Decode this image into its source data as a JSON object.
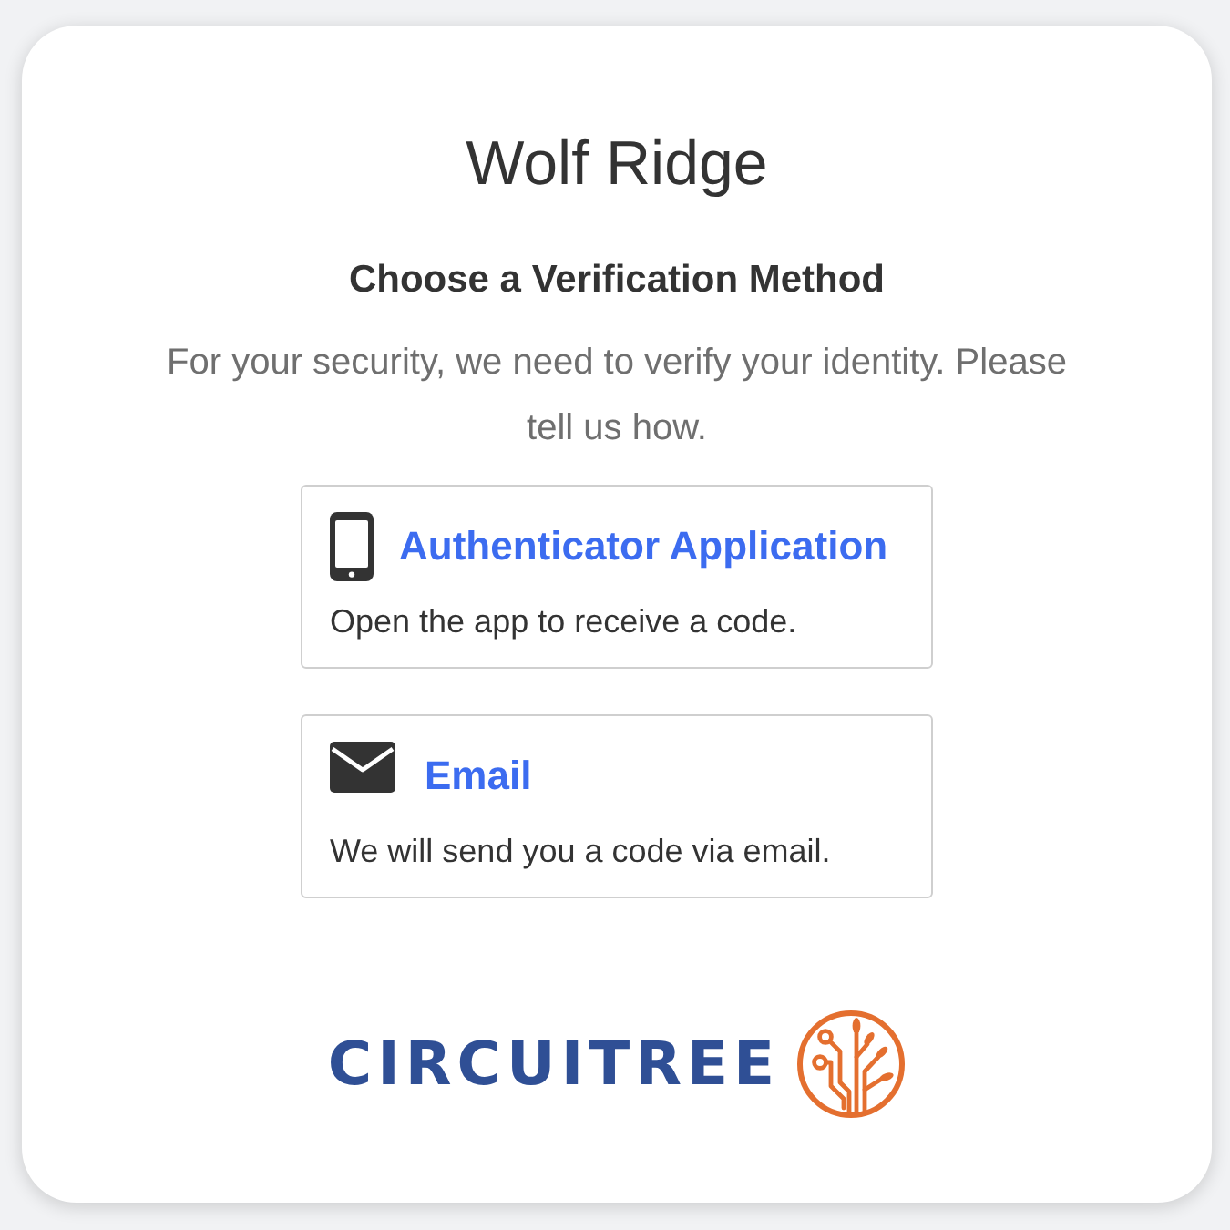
{
  "page": {
    "title": "Wolf Ridge",
    "heading": "Choose a Verification Method",
    "intro": "For your security, we need to verify your identity. Please tell us how."
  },
  "methods": [
    {
      "kind": "phone",
      "title": "Authenticator Application",
      "description": "Open the app to receive a code."
    },
    {
      "kind": "email",
      "title": "Email",
      "description": "We will send you a code via email."
    }
  ],
  "footer_logo": {
    "wordmark": "CIRCUITREE"
  }
}
